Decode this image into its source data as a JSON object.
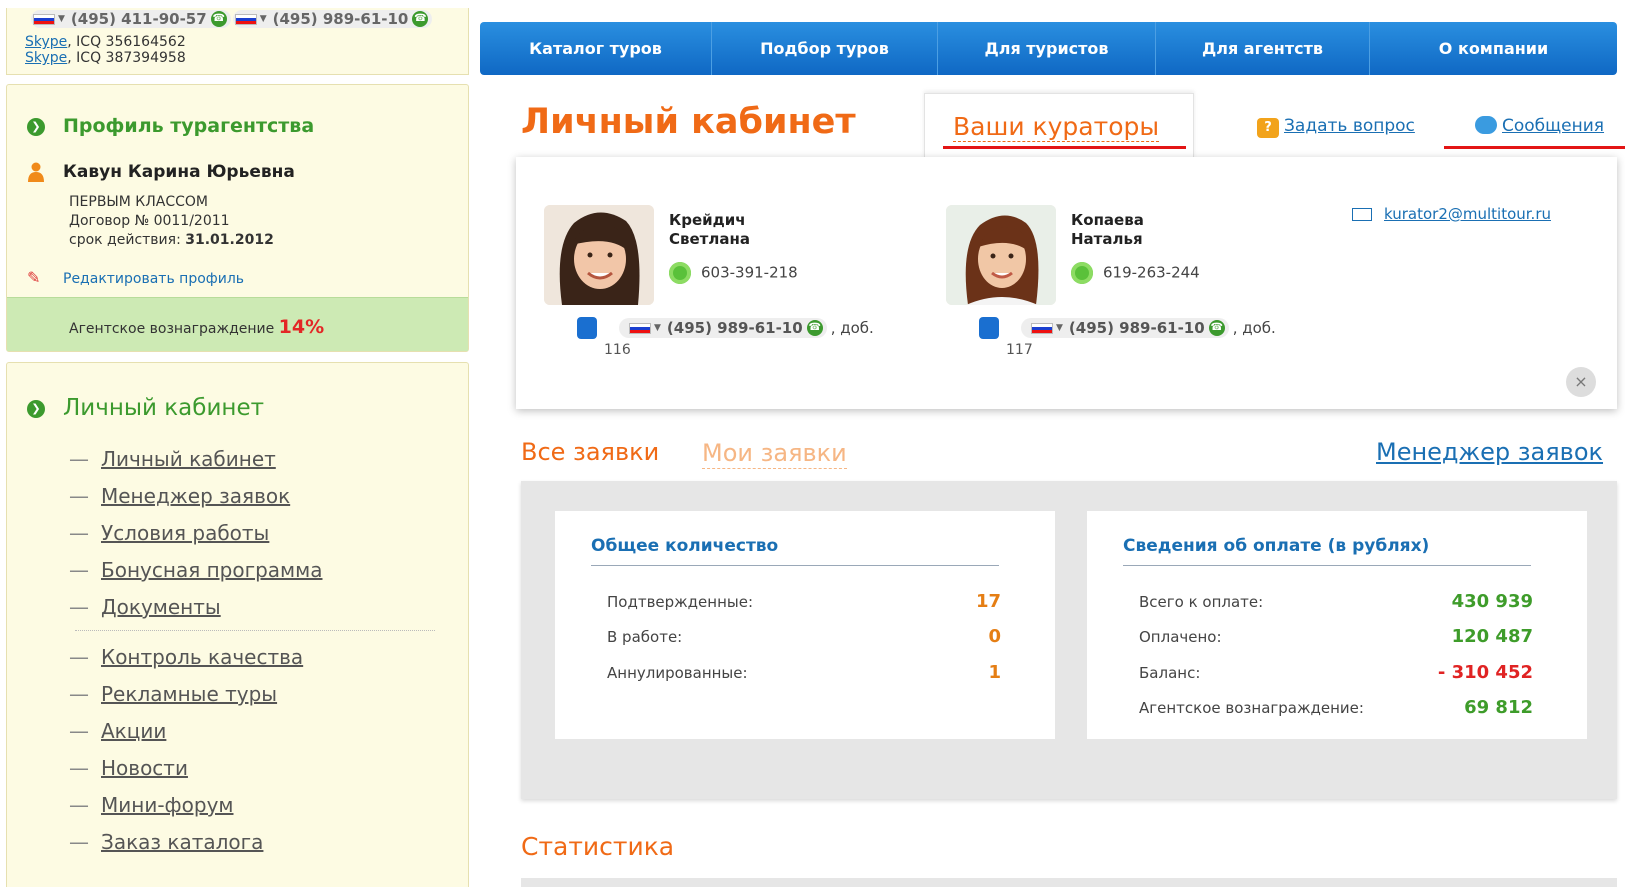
{
  "header": {
    "phone1": "(495) 411-90-57",
    "phone2": "(495) 989-61-10",
    "skype_label": "Skype",
    "icq1": ", ICQ 356164562",
    "icq2": ", ICQ 387394958"
  },
  "nav": {
    "items": [
      "Каталог туров",
      "Подбор туров",
      "Для туристов",
      "Для агентств",
      "О компании"
    ]
  },
  "profile": {
    "title": "Профиль турагентства",
    "name": "Кавун Карина Юрьевна",
    "company": "ПЕРВЫМ КЛАССОМ",
    "contract": "Договор № 0011/2011",
    "valid_label": "срок действия: ",
    "valid_date": "31.01.2012",
    "edit_link": "Редактировать профиль",
    "reward_label": "Агентское вознаграждение ",
    "reward_value": "14%"
  },
  "menu": {
    "title": "Личный кабинет",
    "group1": [
      "Личный кабинет",
      "Менеджер заявок",
      "Условия работы",
      "Бонусная программа",
      "Документы"
    ],
    "group2": [
      "Контроль качества",
      "Рекламные туры",
      "Акции",
      "Новости",
      "Мини-форум",
      "Заказ каталога"
    ],
    "dash": "—"
  },
  "main": {
    "title": "Личный кабинет",
    "tab_curators": "Ваши кураторы",
    "ask_link": "Задать вопрос",
    "ask_icon": "?",
    "messages_link": "Сообщения"
  },
  "curators": [
    {
      "name_line1": "Крейдич",
      "name_line2": "Светлана",
      "icq": "603-391-218",
      "phone": "(495) 989-61-10",
      "after": ", доб.",
      "ext": "116"
    },
    {
      "name_line1": "Копаева",
      "name_line2": "Наталья",
      "icq": "619-263-244",
      "phone": "(495) 989-61-10",
      "after": ", доб.",
      "ext": "117"
    }
  ],
  "curator_email": "kurator2@multitour.ru",
  "close_icon": "×",
  "orders": {
    "all": "Все заявки",
    "mine": "Мои заявки",
    "manager_link": "Менеджер заявок"
  },
  "totals": {
    "title": "Общее количество",
    "rows": [
      {
        "label": "Подтвержденные:",
        "value": "17"
      },
      {
        "label": "В работе:",
        "value": "0"
      },
      {
        "label": "Аннулированные:",
        "value": "1"
      }
    ]
  },
  "payments": {
    "title": "Сведения об оплате (в рублях)",
    "rows": [
      {
        "label": "Всего к оплате:",
        "value": "430 939"
      },
      {
        "label": "Оплачено:",
        "value": "120 487"
      },
      {
        "label": "Баланс:",
        "value": "- 310 452"
      },
      {
        "label": "Агентское вознаграждение:",
        "value": "69 812"
      }
    ]
  },
  "statistics_title": "Статистика"
}
